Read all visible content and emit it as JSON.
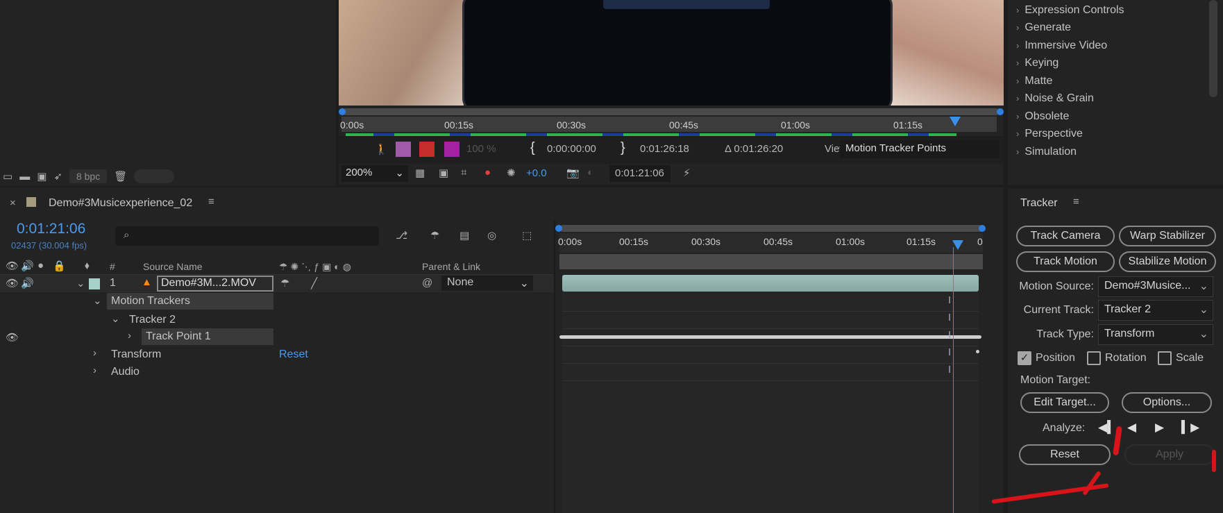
{
  "project": {
    "bpc": "8 bpc"
  },
  "viewer": {
    "ruler_ticks": [
      "0:00s",
      "00:15s",
      "00:30s",
      "00:45s",
      "01:00s",
      "01:15s"
    ],
    "zoom_opacity": "100 %",
    "in_time": "0:00:00:00",
    "out_time": "0:01:26:18",
    "duration": "Δ 0:01:26:20",
    "view_label": "View:",
    "view_value": "Motion Tracker Points",
    "magnification": "200%",
    "exposure": "+0.0",
    "current_time": "0:01:21:06"
  },
  "effects": {
    "items": [
      "Expression Controls",
      "Generate",
      "Immersive Video",
      "Keying",
      "Matte",
      "Noise & Grain",
      "Obsolete",
      "Perspective",
      "Simulation"
    ]
  },
  "timeline": {
    "comp_name": "Demo#3Musicexperience_02",
    "current_time": "0:01:21:06",
    "frame_info": "02437 (30.004 fps)",
    "ruler_ticks": [
      "0:00s",
      "00:15s",
      "00:30s",
      "00:45s",
      "01:00s",
      "01:15s",
      "0"
    ],
    "headers": {
      "number": "#",
      "source": "Source Name",
      "parent": "Parent & Link"
    },
    "layer": {
      "index": "1",
      "name": "Demo#3M...2.MOV",
      "parent": "None"
    },
    "rows": {
      "motion_trackers": "Motion Trackers",
      "tracker2": "Tracker 2",
      "track_point": "Track Point 1",
      "transform": "Transform",
      "reset": "Reset",
      "audio": "Audio"
    }
  },
  "tracker": {
    "title": "Tracker",
    "track_camera": "Track Camera",
    "warp_stabilizer": "Warp Stabilizer",
    "track_motion": "Track Motion",
    "stabilize_motion": "Stabilize Motion",
    "motion_source_label": "Motion Source:",
    "motion_source_value": "Demo#3Musice...",
    "current_track_label": "Current Track:",
    "current_track_value": "Tracker 2",
    "track_type_label": "Track Type:",
    "track_type_value": "Transform",
    "position": "Position",
    "rotation": "Rotation",
    "scale": "Scale",
    "position_checked": true,
    "motion_target_label": "Motion Target:",
    "edit_target": "Edit Target...",
    "options": "Options...",
    "analyze_label": "Analyze:",
    "reset": "Reset",
    "apply": "Apply"
  },
  "colors": {
    "accent_blue": "#4a9aef",
    "annotation_red": "#d8141a",
    "layer_bar": "#8fb0ab"
  }
}
